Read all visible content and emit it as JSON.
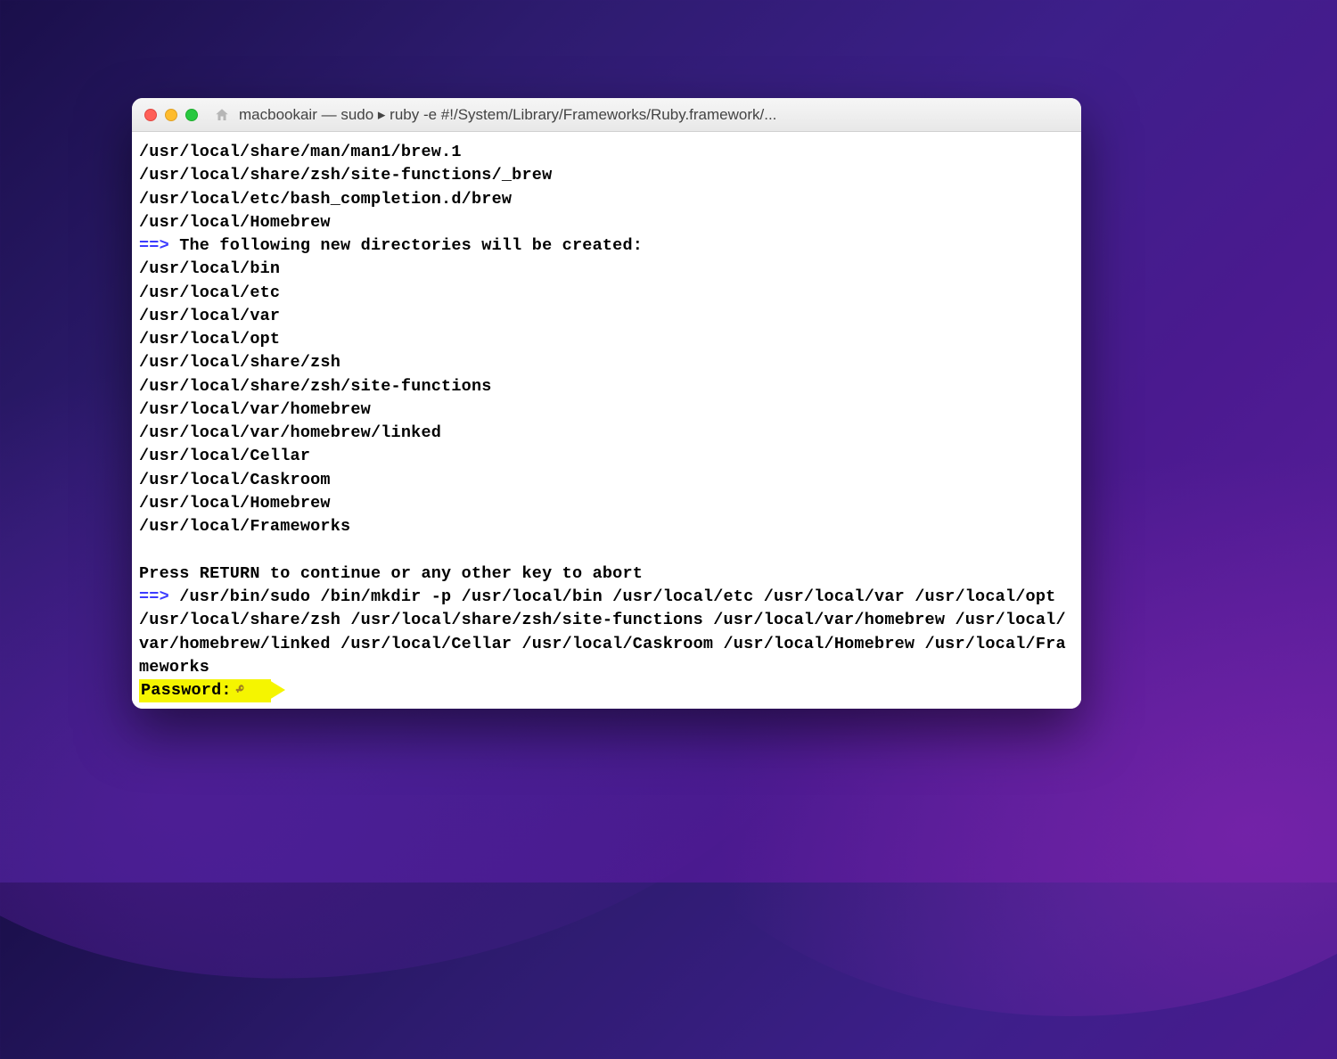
{
  "window": {
    "title": "macbookair — sudo ▸ ruby -e #!/System/Library/Frameworks/Ruby.framework/..."
  },
  "terminal": {
    "preLines": [
      "/usr/local/share/man/man1/brew.1",
      "/usr/local/share/zsh/site-functions/_brew",
      "/usr/local/etc/bash_completion.d/brew",
      "/usr/local/Homebrew"
    ],
    "arrow": "==>",
    "heading1": " The following new directories will be created:",
    "directories": [
      "/usr/local/bin",
      "/usr/local/etc",
      "/usr/local/var",
      "/usr/local/opt",
      "/usr/local/share/zsh",
      "/usr/local/share/zsh/site-functions",
      "/usr/local/var/homebrew",
      "/usr/local/var/homebrew/linked",
      "/usr/local/Cellar",
      "/usr/local/Caskroom",
      "/usr/local/Homebrew",
      "/usr/local/Frameworks"
    ],
    "continuePrompt": "Press RETURN to continue or any other key to abort",
    "sudoCommand": " /usr/bin/sudo /bin/mkdir -p /usr/local/bin /usr/local/etc /usr/local/var /usr/local/opt /usr/local/share/zsh /usr/local/share/zsh/site-functions /usr/local/var/homebrew /usr/local/var/homebrew/linked /usr/local/Cellar /usr/local/Caskroom /usr/local/Homebrew /usr/local/Frameworks",
    "passwordLabel": "Password:"
  }
}
